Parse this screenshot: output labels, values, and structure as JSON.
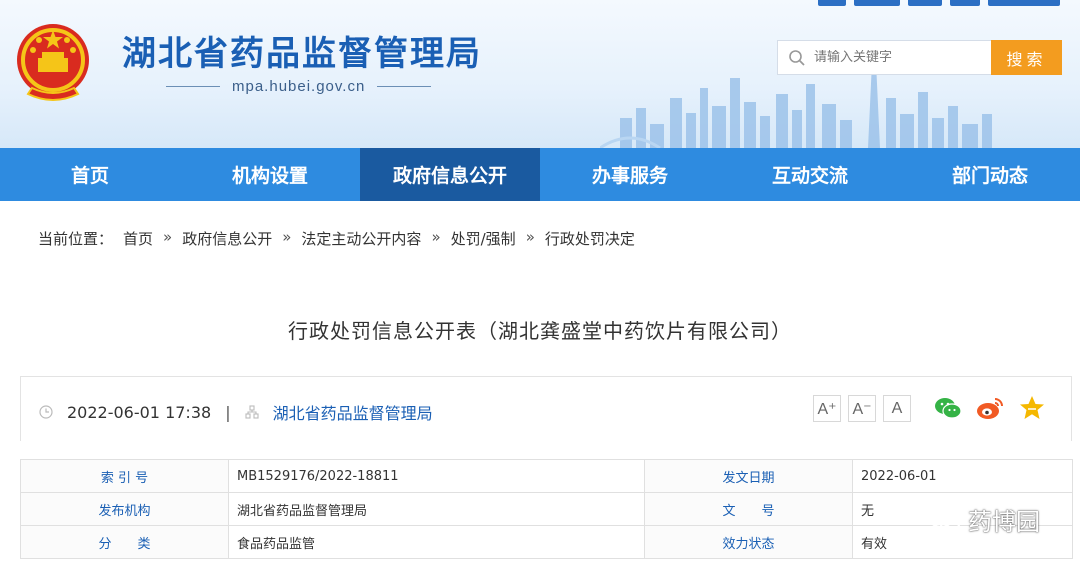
{
  "header": {
    "site_title": "湖北省药品监督管理局",
    "site_domain": "mpa.hubei.gov.cn",
    "search_placeholder": "请输入关键字",
    "search_button": "搜索",
    "brand_color": "#1a5fb4",
    "accent_color": "#f39c1f"
  },
  "nav": {
    "items": [
      {
        "label": "首页"
      },
      {
        "label": "机构设置"
      },
      {
        "label": "政府信息公开"
      },
      {
        "label": "办事服务"
      },
      {
        "label": "互动交流"
      },
      {
        "label": "部门动态"
      }
    ],
    "active_index": 2
  },
  "breadcrumb": {
    "prefix": "当前位置：",
    "items": [
      "首页",
      "政府信息公开",
      "法定主动公开内容",
      "处罚/强制",
      "行政处罚决定"
    ],
    "separator": "»"
  },
  "article": {
    "title": "行政处罚信息公开表（湖北龚盛堂中药饮片有限公司）",
    "date": "2022-06-01 17:38",
    "divider": "|",
    "organization": "湖北省药品监督管理局",
    "font_buttons": [
      "A⁺",
      "A⁻",
      "A"
    ],
    "share_icons": [
      "wechat-icon",
      "weibo-icon",
      "favorite-star-icon"
    ]
  },
  "info_table": {
    "rows": [
      {
        "label1": "索 引 号",
        "value1": "MB1529176/2022-18811",
        "label2": "发文日期",
        "value2": "2022-06-01"
      },
      {
        "label1": "发布机构",
        "value1": "湖北省药品监督管理局",
        "label2": "文　　号",
        "value2": "无"
      },
      {
        "label1": "分　　类",
        "value1": "食品药品监管",
        "label2": "效力状态",
        "value2": "有效"
      }
    ]
  },
  "watermark": {
    "text": "药博园"
  }
}
